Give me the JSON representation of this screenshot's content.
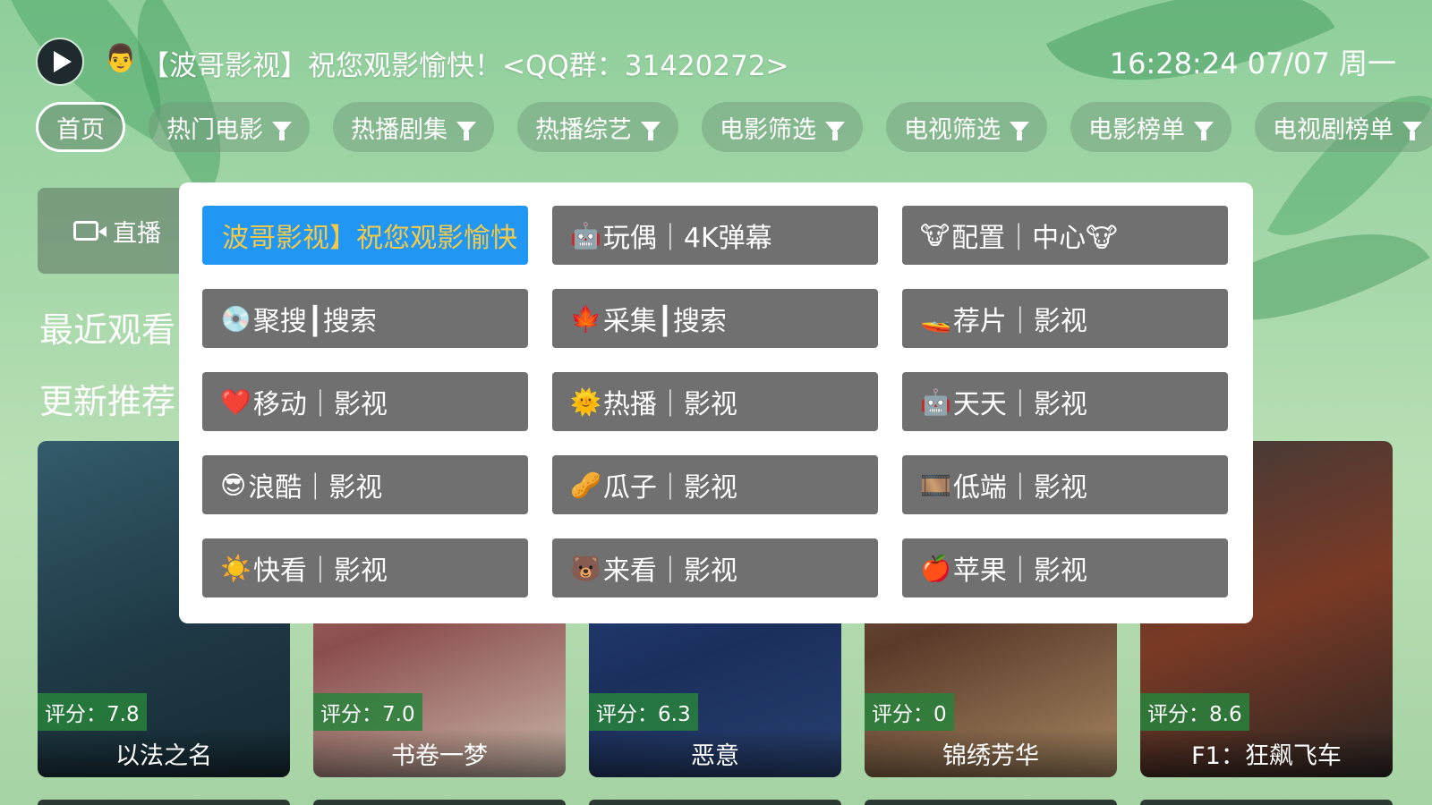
{
  "header": {
    "logo_icon": "play-logo-icon",
    "user_emoji": "👨",
    "title": "【波哥影视】祝您观影愉快！<QQ群：31420272>",
    "clock": "16:28:24 07/07 周一"
  },
  "nav": {
    "items": [
      {
        "label": "首页",
        "active": true
      },
      {
        "label": "热门电影",
        "icon": "filter-icon"
      },
      {
        "label": "热播剧集",
        "icon": "filter-icon"
      },
      {
        "label": "热播综艺",
        "icon": "filter-icon"
      },
      {
        "label": "电影筛选",
        "icon": "filter-icon"
      },
      {
        "label": "电视筛选",
        "icon": "filter-icon"
      },
      {
        "label": "电影榜单",
        "icon": "filter-icon"
      },
      {
        "label": "电视剧榜单",
        "icon": "filter-icon"
      }
    ]
  },
  "live": {
    "label": "直播",
    "icon": "camera-icon"
  },
  "sections": {
    "recent": "最近观看",
    "update": "更新推荐"
  },
  "posters": [
    {
      "title": "以法之名",
      "rating": "评分：7.8"
    },
    {
      "title": "书卷一梦",
      "rating": "评分：7.0"
    },
    {
      "title": "恶意",
      "rating": "评分：6.3"
    },
    {
      "title": "锦绣芳华",
      "rating": "评分：0"
    },
    {
      "title": "F1：狂飙飞车",
      "rating": "评分：8.6"
    }
  ],
  "sites": [
    {
      "icon": "",
      "label": "波哥影视】祝您观影愉快",
      "selected": true
    },
    {
      "icon": "🤖",
      "label": "玩偶｜4K弹幕"
    },
    {
      "icon": "🐮",
      "label": "配置｜中心🐮"
    },
    {
      "icon": "💿",
      "label": "聚搜┃搜索"
    },
    {
      "icon": "🍁",
      "label": "采集┃搜索"
    },
    {
      "icon": "🚤",
      "label": "荐片｜影视"
    },
    {
      "icon": "❤️",
      "label": "移动｜影视"
    },
    {
      "icon": "🌞",
      "label": "热播｜影视"
    },
    {
      "icon": "🤖",
      "label": "天天｜影视"
    },
    {
      "icon": "😎",
      "label": "浪酷｜影视"
    },
    {
      "icon": "🥜",
      "label": "瓜子｜影视"
    },
    {
      "icon": "🎞️",
      "label": "低端｜影视"
    },
    {
      "icon": "☀️",
      "label": "快看｜影视"
    },
    {
      "icon": "🐻",
      "label": "来看｜影视"
    },
    {
      "icon": "🍎",
      "label": "苹果｜影视"
    }
  ]
}
